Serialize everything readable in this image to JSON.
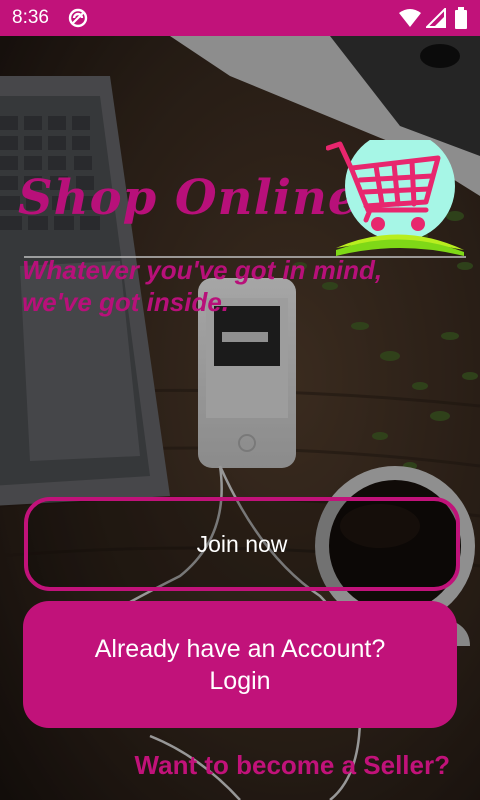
{
  "status_bar": {
    "time": "8:36",
    "icons": [
      "do-not-disturb-icon",
      "wifi-icon",
      "signal-icon",
      "battery-icon"
    ]
  },
  "colors": {
    "brand_magenta": "#c1127a",
    "title_magenta": "#b8107a",
    "cart_circle": "#a6f6e6",
    "cart_base": "#b8ee1f",
    "button_text": "#ffffff"
  },
  "header": {
    "title": "Shop Online",
    "tagline": "Whatever you've got in mind, we've got inside.",
    "logo_icon": "shopping-cart-icon"
  },
  "actions": {
    "join_label": "Join now",
    "login_line1": "Already have an Account?",
    "login_line2": "Login",
    "seller_link": "Want to become a Seller?"
  }
}
